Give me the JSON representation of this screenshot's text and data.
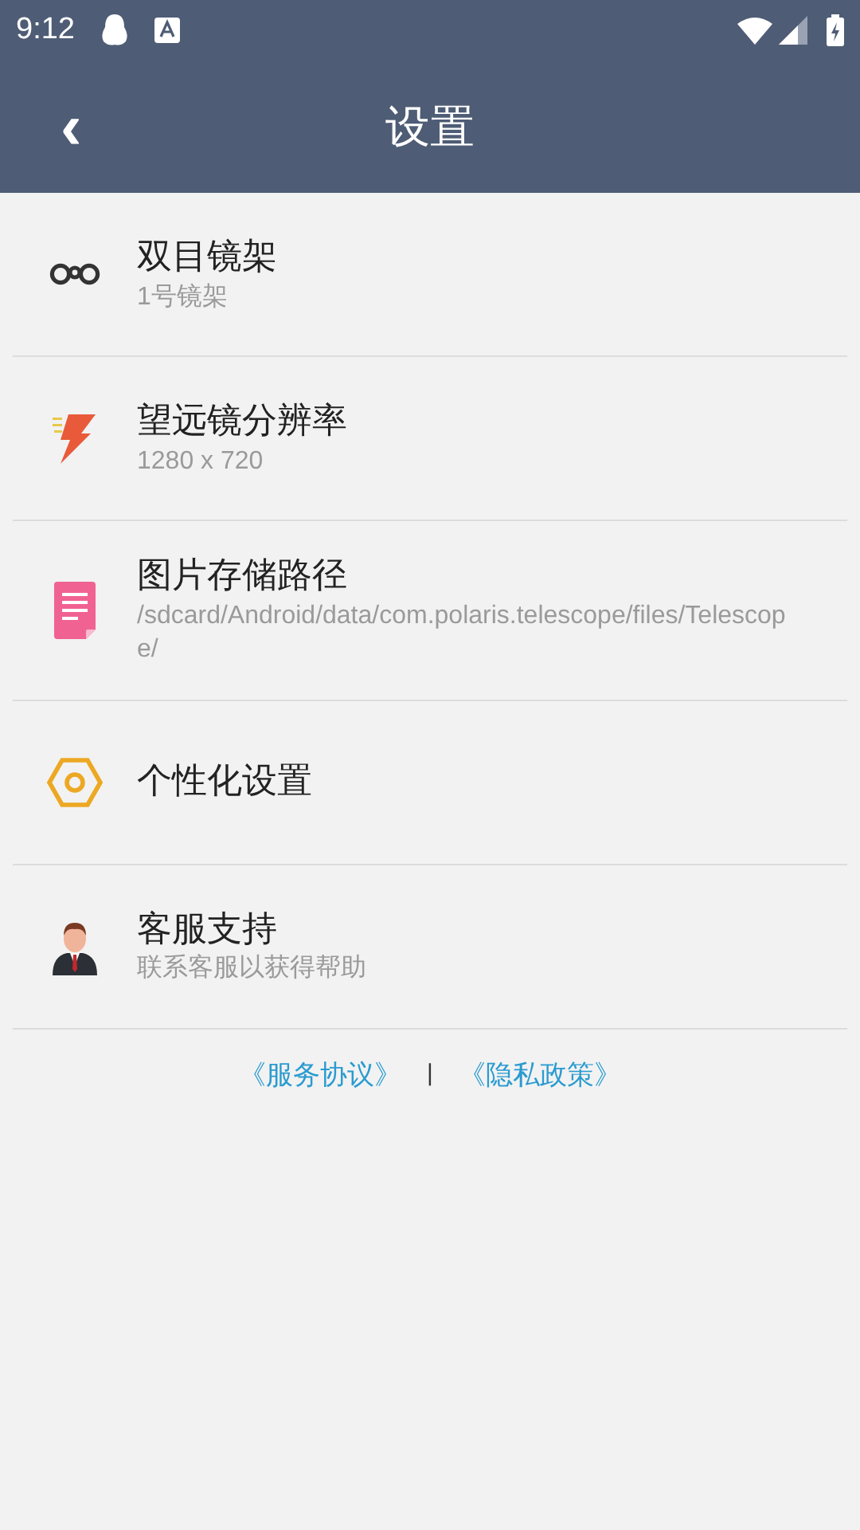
{
  "status_bar": {
    "time": "9:12"
  },
  "header": {
    "back": "‹",
    "title": "设置"
  },
  "items": [
    {
      "kind": "binoculars",
      "title": "双目镜架",
      "subtitle": "1号镜架"
    },
    {
      "kind": "bolt",
      "title": "望远镜分辨率",
      "subtitle": "1280 x 720"
    },
    {
      "kind": "document",
      "title": "图片存储路径",
      "subtitle": "/sdcard/Android/data/com.polaris.telescope/files/Telescope/"
    },
    {
      "kind": "hexagon",
      "title": "个性化设置"
    },
    {
      "kind": "person",
      "title": "客服支持",
      "subtitle": "联系客服以获得帮助"
    }
  ],
  "footer": {
    "links": [
      "《服务协议》",
      "《隐私政策》"
    ],
    "separator": "|"
  }
}
